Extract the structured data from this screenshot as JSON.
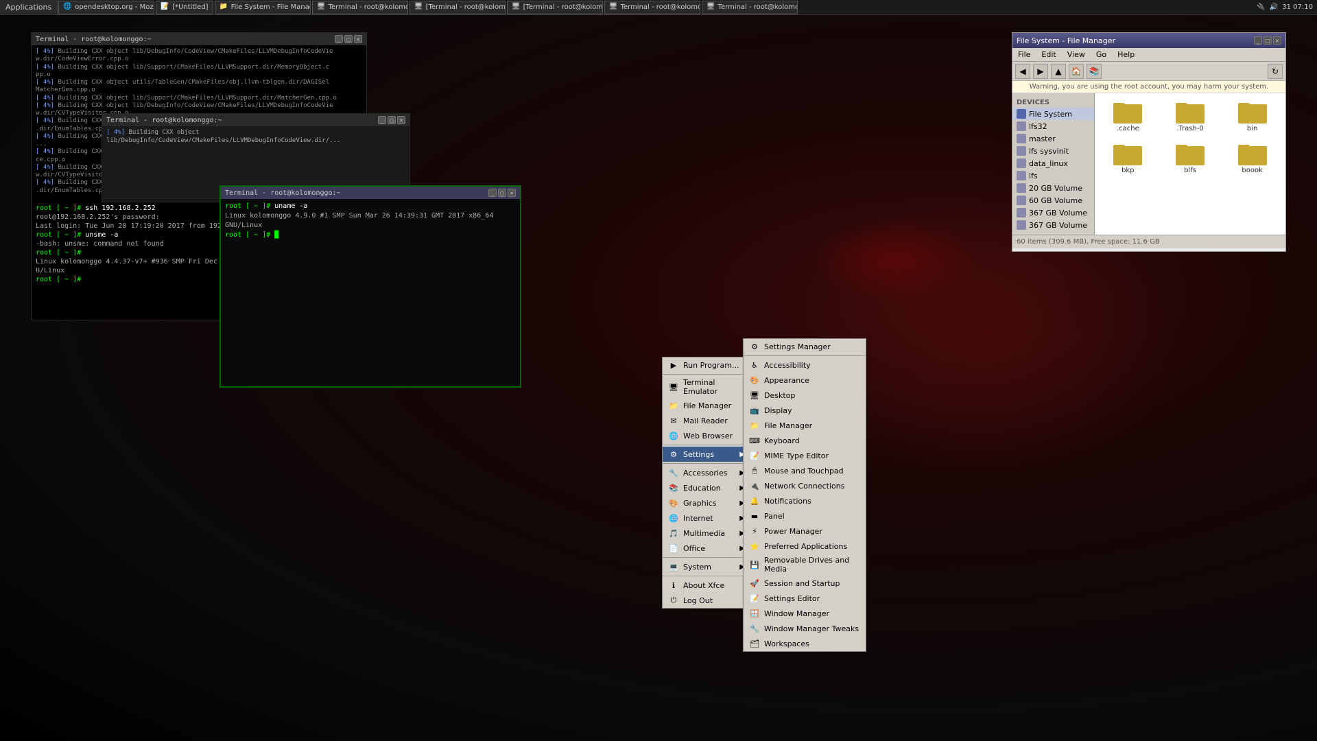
{
  "taskbar": {
    "apps_label": "Applications",
    "buttons": [
      {
        "id": "btn-opendesktop",
        "label": "opendesktop.org - Mozill...",
        "icon": "🌐"
      },
      {
        "id": "btn-untitled",
        "label": "[*Untitled]",
        "icon": "📝"
      },
      {
        "id": "btn-filemanager",
        "label": "File System - File Manager",
        "icon": "📁"
      },
      {
        "id": "btn-terminal1",
        "label": "Terminal - root@kolomon...",
        "icon": "🖥"
      },
      {
        "id": "btn-terminal2",
        "label": "[Terminal - root@kolomo...",
        "icon": "🖥"
      },
      {
        "id": "btn-terminal3",
        "label": "[Terminal - root@kolomo...",
        "icon": "🖥"
      },
      {
        "id": "btn-terminal4",
        "label": "Terminal - root@kolomon...",
        "icon": "🖥"
      },
      {
        "id": "btn-terminal5",
        "label": "Terminal - root@kolomon...",
        "icon": "🖥"
      }
    ],
    "right": {
      "network": "🔌",
      "volume": "🔊",
      "time": "31 07:10",
      "power": "⏻"
    }
  },
  "file_manager": {
    "title": "File System - File Manager",
    "menu": [
      "File",
      "Edit",
      "View",
      "Go",
      "Help"
    ],
    "warning": "Warning, you are using the root account, you may harm your system.",
    "sidebar_section": "DEVICES",
    "sidebar_items": [
      {
        "label": "File System",
        "active": true
      },
      {
        "label": "lfs32"
      },
      {
        "label": "master"
      },
      {
        "label": "lfs sysvinit"
      },
      {
        "label": "data_linux"
      },
      {
        "label": "lfs"
      },
      {
        "label": "20 GB Volume"
      },
      {
        "label": "60 GB Volume"
      },
      {
        "label": "367 GB Volume"
      },
      {
        "label": "367 GB Volume"
      }
    ],
    "files": [
      {
        "label": ".cache"
      },
      {
        "label": ".Trash-0"
      },
      {
        "label": "bin"
      },
      {
        "label": "bkp"
      },
      {
        "label": "blfs"
      },
      {
        "label": "boook"
      }
    ],
    "statusbar": "60 items (309.6 MB), Free space: 11.6 GB"
  },
  "terminal1": {
    "title": "Terminal - root@kolomonggo:~",
    "lines": [
      "[ 4%] Building CXX object lib/DebugInfo/CodeView/CMakeFiles/LLVMDebugInfoCodeView.dir/CodeViewError.cpp.o",
      "[ 4%] Building CXX object lib/Support/CMakeFiles/LLVMSupport.dir/MemoryObject.cpp.o",
      "[ 4%] Building CXX object utils/TableGen/CMakeFiles/obj.llvm-tblgen.dir/DAGISelMatcherGen.cpp.o",
      "[ 4%] Building CXX object lib/Support/CMakeFiles/LLVMSupport.dir/MatcherGen.cpp.o",
      "[ 4%] Building CXX object lib/DebugInfo/CodeView/CMakeFiles/LLVMDebugInfoCodeView.dir/CVTypeVisitor.cpp.o",
      "[ 4%] Building CXX object lib/DebugInfo/CodeView/CMakeFiles/LLVMDebugInfoCodeView.dir/EnumTables.cpp.o"
    ]
  },
  "terminal2": {
    "title": "Terminal - root@kolomonggo:~",
    "ssh_cmd": "ssh 192.168.2.252",
    "password_prompt": "root@192.168.2.252's password:",
    "login_info": "Last login: Tue Jun 20 17:19:20 2017 from 192.168.2.253",
    "unsme_cmd": "unsme -a",
    "unsme_error": "-bash: unsme: command not found",
    "uname_line": "Linux kolomonggo 4.4.37-v7+ #936 SMP Fri Dec 9 16:56:49 GMT 2016 armv7l GNU/Linux"
  },
  "terminal3": {
    "title": "Terminal - root@kolomonggo:~",
    "uname_cmd": "uname -a",
    "uname_output": "Linux kolomonggo 4.9.0 #1 SMP Sun Mar 26 14:39:31 GMT 2017 x86_64 GNU/Linux",
    "prompt": "root [ ~ ]#"
  },
  "context_menu_main": {
    "items": [
      {
        "label": "Run Program...",
        "icon": "▶",
        "has_sub": false
      },
      {
        "label": "Terminal Emulator",
        "icon": "🖥",
        "has_sub": false
      },
      {
        "label": "File Manager",
        "icon": "📁",
        "has_sub": false
      },
      {
        "label": "Mail Reader",
        "icon": "✉",
        "has_sub": false
      },
      {
        "label": "Web Browser",
        "icon": "🌐",
        "has_sub": false
      },
      {
        "separator": true
      },
      {
        "label": "Settings",
        "icon": "⚙",
        "has_sub": true,
        "active": true
      },
      {
        "separator": true
      },
      {
        "label": "Accessories",
        "icon": "🔧",
        "has_sub": true
      },
      {
        "label": "Education",
        "icon": "📚",
        "has_sub": true
      },
      {
        "label": "Graphics",
        "icon": "🎨",
        "has_sub": true
      },
      {
        "label": "Internet",
        "icon": "🌐",
        "has_sub": true
      },
      {
        "label": "Multimedia",
        "icon": "🎵",
        "has_sub": true
      },
      {
        "label": "Office",
        "icon": "📄",
        "has_sub": true
      },
      {
        "separator": true
      },
      {
        "label": "System",
        "icon": "💻",
        "has_sub": true
      },
      {
        "separator": true
      },
      {
        "label": "About Xfce",
        "icon": "ℹ",
        "has_sub": false
      },
      {
        "label": "Log Out",
        "icon": "⏻",
        "has_sub": false
      }
    ]
  },
  "context_menu_settings": {
    "title": "Settings",
    "items": [
      {
        "label": "Settings Manager",
        "icon": "⚙"
      },
      {
        "separator": true
      },
      {
        "label": "Accessibility",
        "icon": "♿"
      },
      {
        "label": "Appearance",
        "icon": "🎨"
      },
      {
        "label": "Desktop",
        "icon": "🖥"
      },
      {
        "label": "Display",
        "icon": "📺"
      },
      {
        "label": "File Manager",
        "icon": "📁"
      },
      {
        "label": "Keyboard",
        "icon": "⌨"
      },
      {
        "label": "MIME Type Editor",
        "icon": "📝"
      },
      {
        "label": "Mouse and Touchpad",
        "icon": "🖱"
      },
      {
        "label": "Network Connections",
        "icon": "🔌"
      },
      {
        "label": "Notifications",
        "icon": "🔔"
      },
      {
        "label": "Panel",
        "icon": "▬"
      },
      {
        "label": "Power Manager",
        "icon": "⚡"
      },
      {
        "label": "Preferred Applications",
        "icon": "⭐"
      },
      {
        "label": "Removable Drives and Media",
        "icon": "💾"
      },
      {
        "label": "Session and Startup",
        "icon": "🚀"
      },
      {
        "label": "Settings Editor",
        "icon": "📝"
      },
      {
        "label": "Window Manager",
        "icon": "🪟"
      },
      {
        "label": "Window Manager Tweaks",
        "icon": "🔧"
      },
      {
        "label": "Workspaces",
        "icon": "🗂"
      }
    ]
  }
}
